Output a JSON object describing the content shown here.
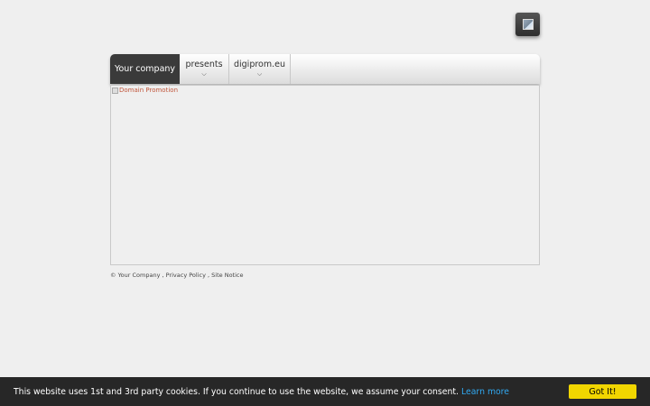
{
  "language_button": {
    "icon": "image-placeholder-icon"
  },
  "nav": {
    "items": [
      {
        "label": "Your company",
        "has_submenu": false,
        "active": true
      },
      {
        "label": "presents",
        "has_submenu": true,
        "active": false
      },
      {
        "label": "digiprom.eu",
        "has_submenu": true,
        "active": false
      }
    ],
    "chevron": "⌄"
  },
  "content": {
    "image_alt": "Domain Promotion"
  },
  "footer": {
    "copyright": "© Your Company",
    "sep1": " , ",
    "privacy": "Privacy Policy",
    "sep2": " , ",
    "notice": "Site Notice"
  },
  "cookie_banner": {
    "message": "This website uses 1st and 3rd party cookies. If you continue to use the website, we assume your consent.",
    "learn_more": "Learn more",
    "accept": "Got It!"
  },
  "colors": {
    "background": "#efefef",
    "nav_active": "#3a3a3a",
    "cookie_bg": "#272727",
    "cookie_link": "#31a8f0",
    "cookie_button": "#f1d600"
  }
}
